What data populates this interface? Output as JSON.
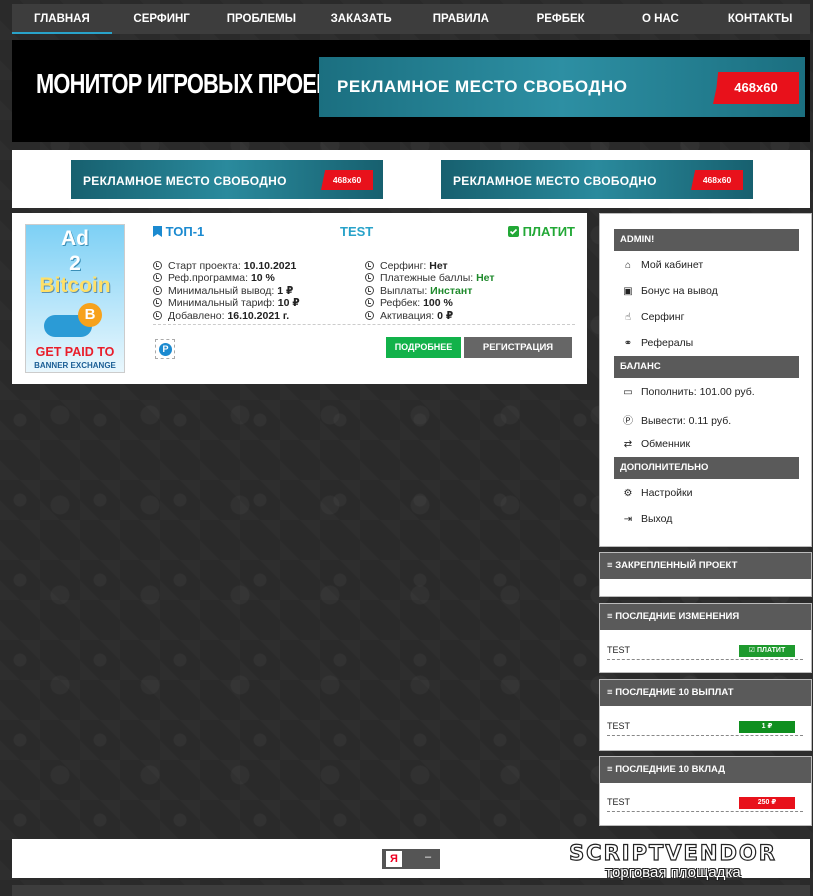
{
  "nav": {
    "items": [
      "ГЛАВНАЯ",
      "СЕРФИНГ",
      "ПРОБЛЕМЫ",
      "ЗАКАЗАТЬ",
      "ПРАВИЛА",
      "РЕФБЕК",
      "О НАС",
      "КОНТАКТЫ"
    ],
    "active": "ГЛАВНАЯ"
  },
  "header": {
    "title": "МОНИТОР ИГРОВЫХ ПРОЕКТОВ",
    "ad_big": {
      "text": "РЕКЛАМНОЕ  МЕСТО СВОБОДНО",
      "size": "468x60"
    }
  },
  "adbar": {
    "left": {
      "text": "РЕКЛАМНОЕ  МЕСТО СВОБОДНО",
      "size": "468x60"
    },
    "right": {
      "text": "РЕКЛАМНОЕ  МЕСТО СВОБОДНО",
      "size": "468x60"
    }
  },
  "project": {
    "banner": {
      "line1": "Ad",
      "line2": "2",
      "line3": "Bitcoin",
      "line4": "GET PAID TO",
      "line5": "BANNER EXCHANGE",
      "coin": "B"
    },
    "top_label": "ТОП-1",
    "name": "TEST",
    "status": "ПЛАТИТ",
    "left_info": [
      {
        "label": "Старт проекта:",
        "value": "10.10.2021"
      },
      {
        "label": "Реф.программа:",
        "value": "10 %"
      },
      {
        "label": "Минимальный вывод:",
        "value": "1 ₽"
      },
      {
        "label": "Минимальный тариф:",
        "value": "10 ₽"
      },
      {
        "label": "Добавлено:",
        "value": "16.10.2021 г."
      }
    ],
    "right_info": [
      {
        "label": "Серфинг:",
        "value": "Нет"
      },
      {
        "label": "Платежные баллы:",
        "value": "Нет"
      },
      {
        "label": "Выплаты:",
        "value": "Инстант"
      },
      {
        "label": "Рефбек:",
        "value": "100 %"
      },
      {
        "label": "Активация:",
        "value": "0 ₽"
      }
    ],
    "payment_icon": "P",
    "btn_more": "ПОДРОБНЕЕ",
    "btn_reg": "РЕГИСТРАЦИЯ"
  },
  "sidebar": {
    "user_head": "ADMIN!",
    "user_menu": [
      "Мой кабинет",
      "Бонус на вывод",
      "Серфинг",
      "Рефералы"
    ],
    "balance_head": "БАЛАНС",
    "balance_menu": [
      "Пополнить: 101.00 руб.",
      "Вывести: 0.11 руб.",
      "Обменник"
    ],
    "extra_head": "ДОПОЛНИТЕЛЬНО",
    "extra_menu": [
      "Настройки",
      "Выход"
    ]
  },
  "panels": {
    "pinned": {
      "title": "ЗАКРЕПЛЕННЫЙ ПРОЕКТ"
    },
    "changes": {
      "title": "ПОСЛЕДНИЕ ИЗМЕНЕНИЯ",
      "row": "TEST",
      "badge": "ПЛАТИТ"
    },
    "payouts": {
      "title": "ПОСЛЕДНИЕ 10 ВЫПЛАТ",
      "row": "TEST",
      "badge": "1 ₽"
    },
    "deposits": {
      "title": "ПОСЛЕДНИЕ 10 ВКЛАД",
      "row": "TEST",
      "badge": "250 ₽"
    }
  },
  "footer": {
    "counter_logo": "Я",
    "counter_value": "–",
    "vendor_title": "SCRIPTVENDOR",
    "vendor_sub": "торговая площадка"
  },
  "colors": {
    "green": "#12b24a",
    "red": "#e8111b",
    "blue": "#1b8ad0",
    "dark": "#3d3d3d"
  }
}
